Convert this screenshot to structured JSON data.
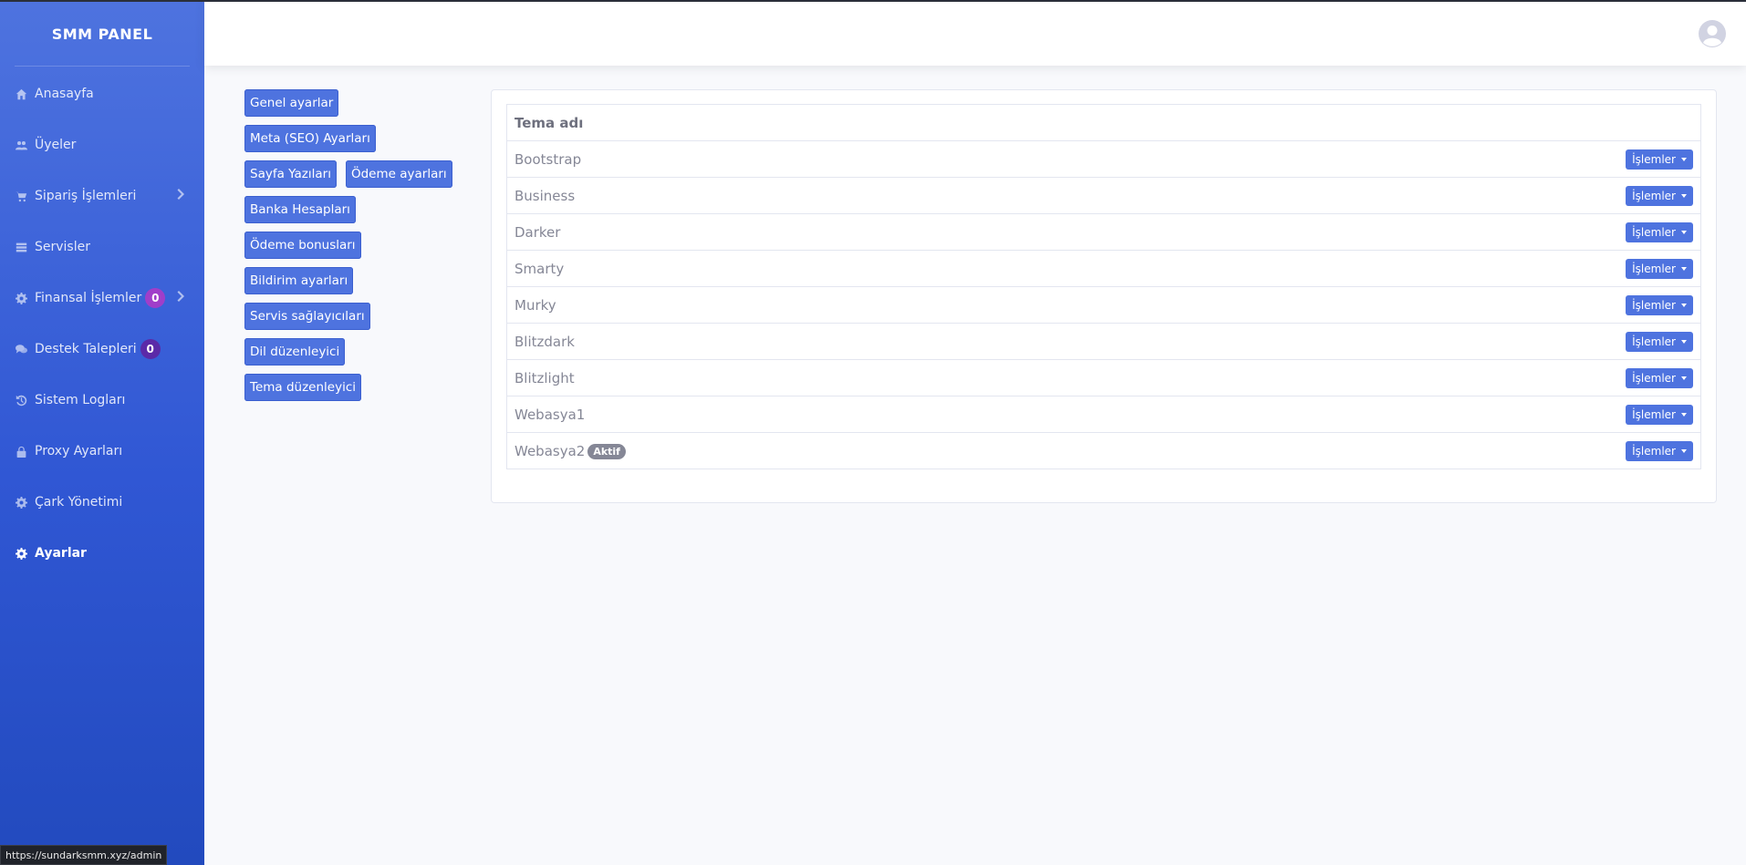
{
  "brand": {
    "title": "SMM PANEL"
  },
  "sidebar": {
    "items": [
      {
        "label": "Anasayfa"
      },
      {
        "label": "Üyeler"
      },
      {
        "label": "Sipariş İşlemleri"
      },
      {
        "label": "Servisler"
      },
      {
        "label": "Finansal İşlemler",
        "badge": "0"
      },
      {
        "label": "Destek Talepleri",
        "badge": "0"
      },
      {
        "label": "Sistem Logları"
      },
      {
        "label": "Proxy Ayarları"
      },
      {
        "label": "Çark Yönetimi"
      },
      {
        "label": "Ayarlar"
      }
    ]
  },
  "settings_menu": {
    "general": "Genel ayarlar",
    "meta": "Meta (SEO) Ayarları",
    "pages": "Sayfa Yazıları",
    "payment": "Ödeme ayarları",
    "bank": "Banka Hesapları",
    "bonus": "Ödeme bonusları",
    "notification": "Bildirim ayarları",
    "providers": "Servis sağlayıcıları",
    "language": "Dil düzenleyici",
    "theme": "Tema düzenleyici"
  },
  "theme_table": {
    "header": "Tema adı",
    "action_label": "İşlemler",
    "rows": [
      {
        "name": "Bootstrap"
      },
      {
        "name": "Business"
      },
      {
        "name": "Darker"
      },
      {
        "name": "Smarty"
      },
      {
        "name": "Murky"
      },
      {
        "name": "Blitzdark"
      },
      {
        "name": "Blitzlight"
      },
      {
        "name": "Webasya1"
      },
      {
        "name": "Webasya2",
        "badge": "Aktif"
      }
    ]
  },
  "status_bar": {
    "url": "https://sundarksmm.xyz/admin"
  },
  "colors": {
    "primary": "#4e73df",
    "sidebar_bottom": "#224abe",
    "badge_magenta": "#a03ec9",
    "badge_purple": "#5b2aa8",
    "badge_secondary": "#858796"
  },
  "icons": {
    "home": "home-icon",
    "users": "users-icon",
    "cart": "cart-icon",
    "list": "list-icon",
    "cog": "cog-icon",
    "comments": "comments-icon",
    "history": "history-icon",
    "lock": "lock-icon",
    "avatar": "user-circle-icon"
  }
}
